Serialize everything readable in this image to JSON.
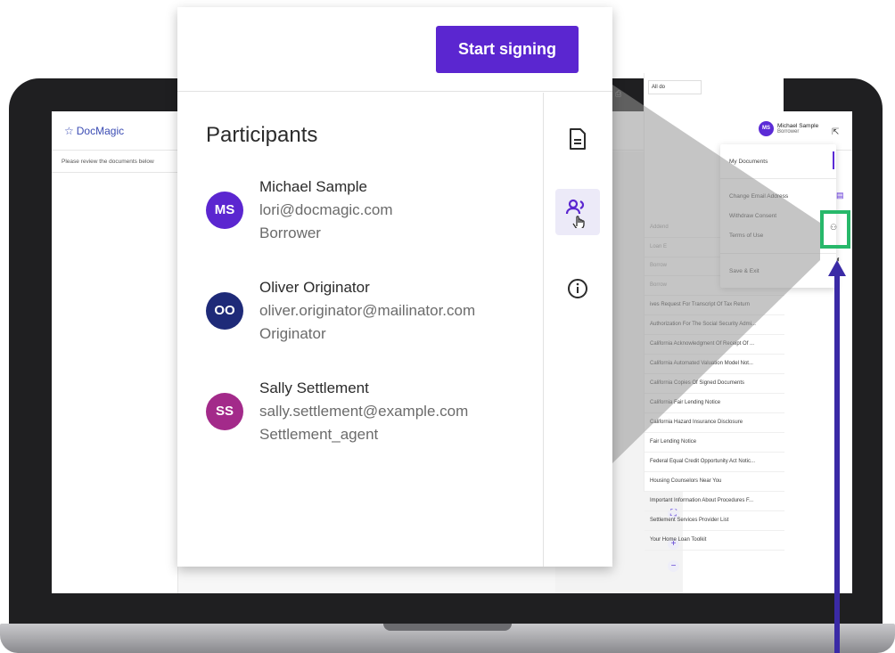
{
  "app": {
    "logo_star": "☆",
    "logo_text": "DocMagic",
    "review_text": "Please review the documents below"
  },
  "user": {
    "initials": "MS",
    "name": "Michael Sample",
    "role": "Borrower"
  },
  "user_menu": {
    "items": [
      "My Documents",
      "Change Email Address",
      "Withdraw Consent",
      "Terms of Use",
      "Save & Exit"
    ]
  },
  "doc_list": {
    "select_value": "All do",
    "faded_items": [
      "Addend",
      "Loan E",
      "Borrow",
      "Borrow"
    ],
    "items": [
      "ives Request For Transcript Of Tax Return",
      "Authorization For The Social Security Admi...",
      "California Acknowledgment Of Receipt Of ...",
      "California Automated Valuation Model Not...",
      "California Copies Of Signed Documents",
      "California Fair Lending Notice",
      "California Hazard Insurance Disclosure",
      "Fair Lending Notice",
      "Federal Equal Credit Opportunity Act Notic...",
      "Housing Counselors Near You",
      "Important Information About Procedures F...",
      "Settlement Services Provider List",
      "Your Home Loan Toolkit"
    ]
  },
  "popover": {
    "start_button": "Start signing",
    "title": "Participants",
    "participants": [
      {
        "initials": "MS",
        "name": "Michael Sample",
        "email": "lori@docmagic.com",
        "role": "Borrower",
        "color": "#5b26d0"
      },
      {
        "initials": "OO",
        "name": "Oliver Originator",
        "email": "oliver.originator@mailinator.com",
        "role": "Originator",
        "color": "#1e2a78"
      },
      {
        "initials": "SS",
        "name": "Sally Settlement",
        "email": "sally.settlement@example.com",
        "role": "Settlement_agent",
        "color": "#a32a8a"
      }
    ]
  },
  "colors": {
    "brand": "#5b26d0",
    "highlight": "#27b86a",
    "arrow": "#3a2aa6"
  }
}
